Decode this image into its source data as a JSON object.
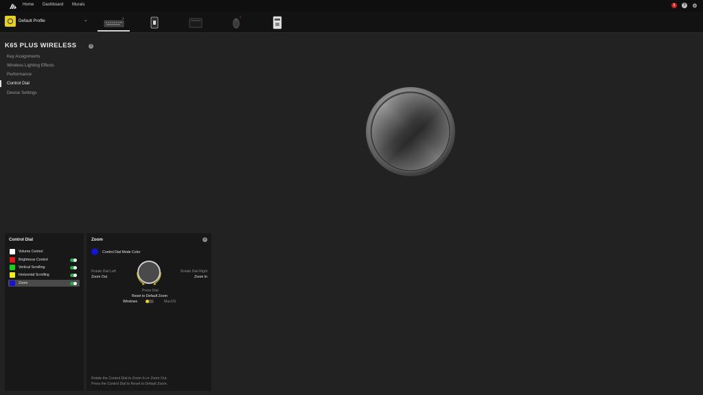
{
  "nav": {
    "links": [
      "Home",
      "Dashboard",
      "Murals"
    ],
    "alert_count": "1",
    "help": "?",
    "settings": "⚙"
  },
  "profile": {
    "name": "Default Profile",
    "color": "#e6d11a"
  },
  "devices": [
    {
      "icon": "keyboard-icon",
      "selected": true
    },
    {
      "icon": "usb-dongle-icon",
      "selected": false
    },
    {
      "icon": "dark-device-icon",
      "selected": false
    },
    {
      "icon": "mouse-icon",
      "selected": false
    },
    {
      "icon": "hub-icon",
      "selected": false
    }
  ],
  "device": {
    "title": "K65 PLUS WIRELESS",
    "info": "i"
  },
  "sidebar": {
    "items": [
      {
        "label": "Key Assignments",
        "active": false
      },
      {
        "label": "Wireless Lighting Effects",
        "active": false
      },
      {
        "label": "Performance",
        "active": false
      },
      {
        "label": "Control Dial",
        "active": true
      },
      {
        "label": "Device Settings",
        "active": false
      }
    ]
  },
  "control_dial_panel": {
    "title": "Control Dial",
    "modes": [
      {
        "label": "Volume Control",
        "color": "#ffffff",
        "toggle": false,
        "selected": false
      },
      {
        "label": "Brightness Control",
        "color": "#e01717",
        "toggle": true,
        "selected": false
      },
      {
        "label": "Vertical Scrolling",
        "color": "#19d119",
        "toggle": true,
        "selected": false
      },
      {
        "label": "Horizontal Scrolling",
        "color": "#f2ee18",
        "toggle": true,
        "selected": false
      },
      {
        "label": "Zoom",
        "color": "#1414d6",
        "toggle": true,
        "selected": true
      }
    ]
  },
  "zoom_panel": {
    "title": "Zoom",
    "info": "i",
    "mode_color_label": "Control Dial Mode Color",
    "mode_color": "#1414d6",
    "rotate_left_label": "Rotate Dial Left",
    "rotate_left_action": "Zoom Out",
    "rotate_right_label": "Rotate Dial Right",
    "rotate_right_action": "Zoom In",
    "press_label": "Press Dial",
    "press_action": "Reset to Default Zoom",
    "os_left": "Windows",
    "os_right": "MacOS",
    "footer_line1": "Rotate the Control Dial to Zoom In or Zoom Out.",
    "footer_line2": "Press the Control Dial to Reset to Default Zoom."
  }
}
